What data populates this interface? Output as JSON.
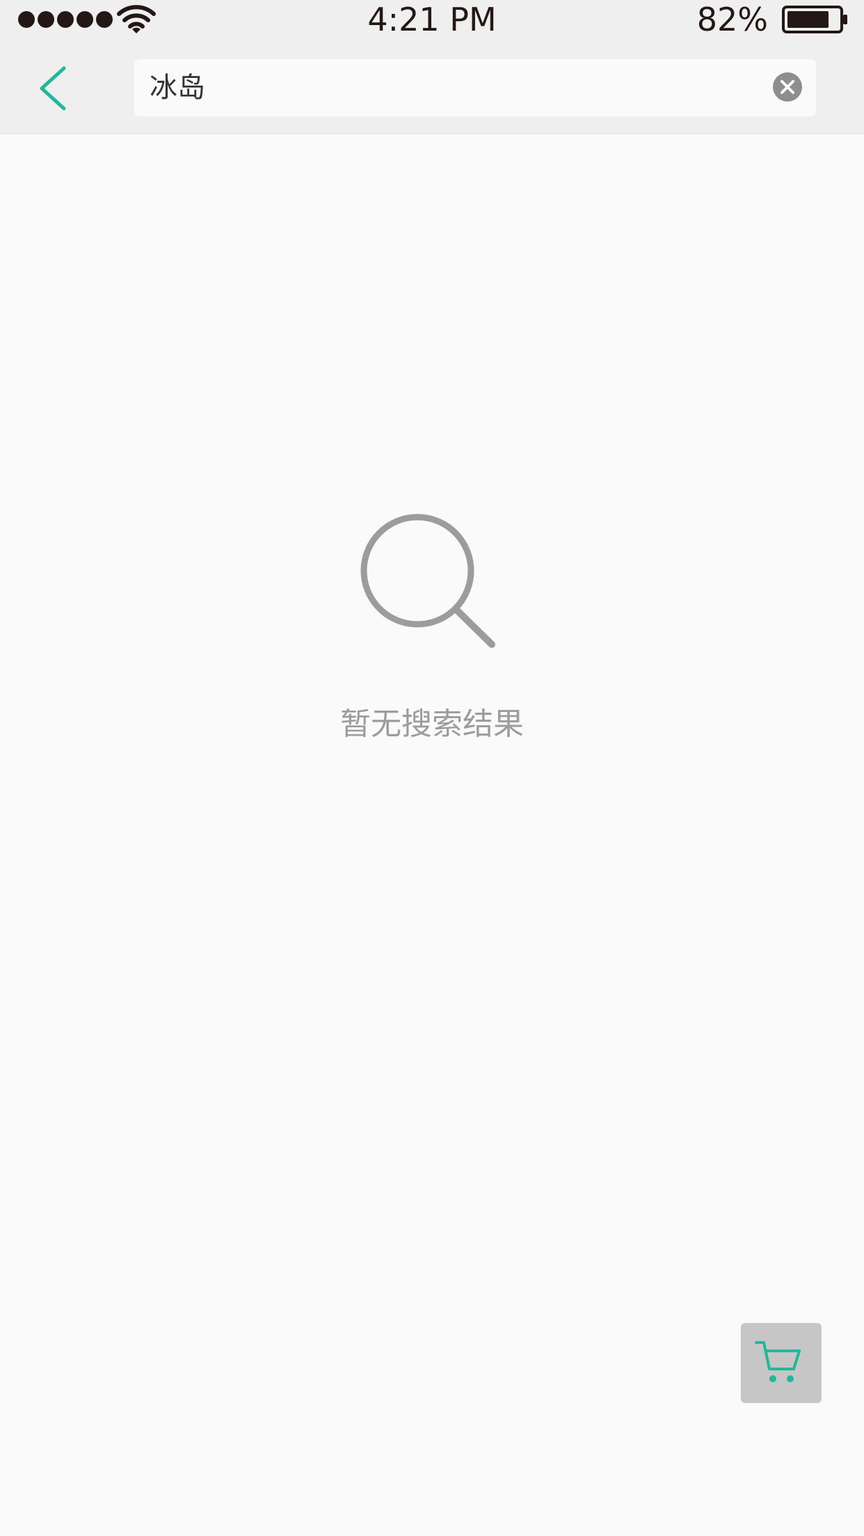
{
  "status_bar": {
    "time": "4:21 PM",
    "battery_percent": "82%",
    "signal_bars": 5,
    "battery_level": 0.82,
    "icons": [
      "signal-dots-icon",
      "wifi-icon",
      "battery-icon"
    ]
  },
  "nav": {
    "back_icon": "chevron-left-icon",
    "search_value": "冰岛",
    "clear_icon": "clear-circle-icon"
  },
  "empty_state": {
    "icon": "search-icon",
    "message": "暂无搜索结果"
  },
  "cart": {
    "icon": "cart-icon"
  },
  "colors": {
    "accent": "#1fb89a",
    "status_text": "#231815",
    "empty_gray": "#9c9c9c",
    "cart_bg": "#c6c6c6",
    "bar_bg": "#efefef",
    "page_bg": "#fafafa"
  }
}
